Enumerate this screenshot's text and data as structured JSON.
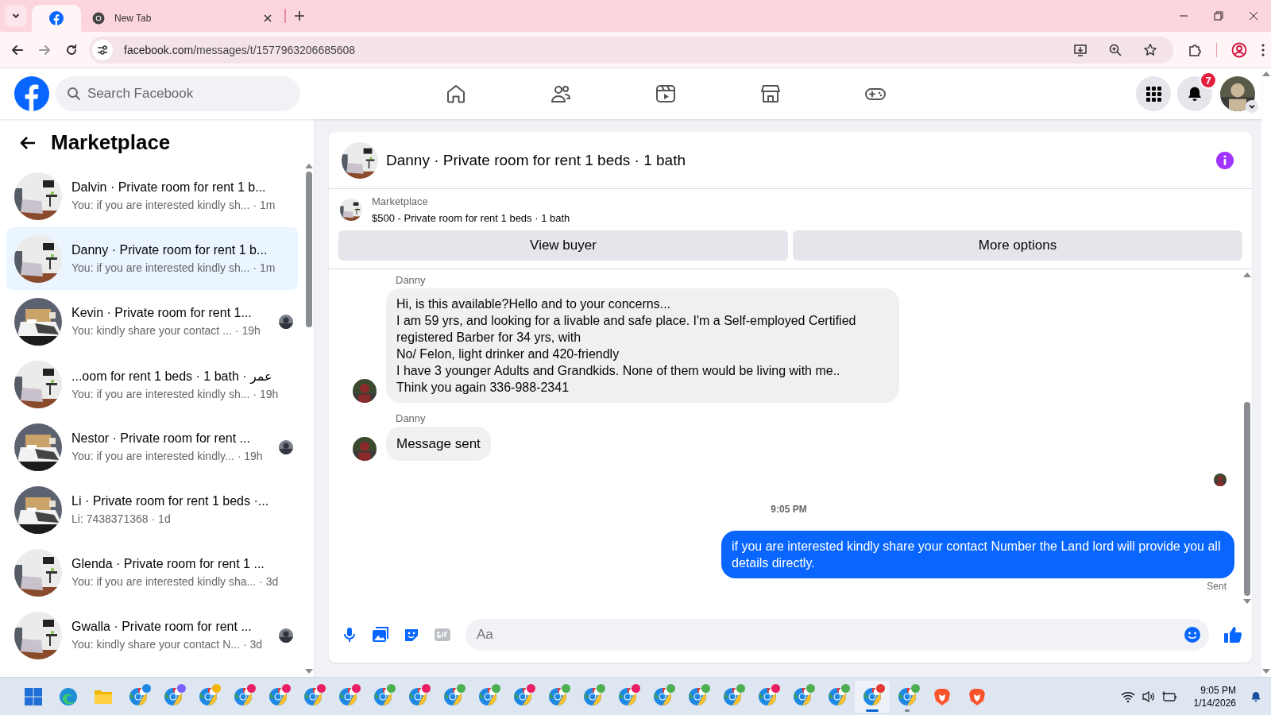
{
  "browser": {
    "tabs": [
      {
        "kind": "facebook",
        "selected": true
      },
      {
        "title": "New Tab",
        "kind": "chrome",
        "selected": false
      }
    ],
    "url_host": "facebook.com",
    "url_path": "/messages/t/1577963206685608"
  },
  "header": {
    "search": {
      "placeholder": "Search Facebook"
    },
    "nav": [
      {
        "kind": "home",
        "selected": false
      },
      {
        "kind": "friends",
        "selected": false
      },
      {
        "kind": "video",
        "selected": false
      },
      {
        "kind": "marketplace",
        "selected": false
      },
      {
        "kind": "gaming",
        "selected": false
      }
    ],
    "notification_count": "7"
  },
  "sidebar": {
    "title": "Marketplace",
    "conversations": [
      {
        "title": "Dalvin · Private room for rent 1 b...",
        "preview": "You: if you are interested kindly sh...",
        "time": "· 1m",
        "selected": false,
        "seen_avatar": false
      },
      {
        "title": "Danny · Private room for rent 1 b...",
        "preview": "You: if you are interested kindly sh...",
        "time": "· 1m",
        "selected": true,
        "seen_avatar": false
      },
      {
        "title": "Kevin · Private room for rent 1...",
        "preview": "You: kindly share your contact ...",
        "time": "· 19h",
        "selected": false,
        "seen_avatar": true
      },
      {
        "title": "...oom for rent 1 beds · 1 bath · عمر",
        "preview": "You: if you are interested kindly sh...",
        "time": "· 19h",
        "selected": false,
        "seen_avatar": false
      },
      {
        "title": "Nestor · Private room for rent ...",
        "preview": "You: if you are interested kindly...",
        "time": "· 19h",
        "selected": false,
        "seen_avatar": true
      },
      {
        "title": "Li · Private room for rent 1 beds ·...",
        "preview": "Li: 7438371368",
        "time": "· 1d",
        "selected": false,
        "seen_avatar": false
      },
      {
        "title": "Glenda · Private room for rent 1 ...",
        "preview": "You: if you are interested kindly sha...",
        "time": "· 3d",
        "selected": false,
        "seen_avatar": false
      },
      {
        "title": "Gwalla · Private room for rent ...",
        "preview": "You: kindly share your contact N...",
        "time": "· 3d",
        "selected": false,
        "seen_avatar": true
      }
    ]
  },
  "chat": {
    "title": "Danny · Private room for rent 1 beds · 1 bath",
    "listing": {
      "source": "Marketplace",
      "text": "$500 - Private room for rent 1 beds · 1 bath"
    },
    "buttons": [
      "View buyer",
      "More options"
    ],
    "messages": [
      {
        "kind": "incoming",
        "sender": "Danny",
        "text": "Hi, is this available?Hello and to your concerns...\nI am 59 yrs, and looking for a livable and safe place. I'm a Self-employed Certified registered Barber for 34 yrs, with\nNo/ Felon, light drinker and 420-friendly\nI have 3 younger Adults and Grandkids. None of them would be living with me..\nThink you again 336-988-2341"
      },
      {
        "kind": "notice",
        "sender": "Danny",
        "text": "Message sent"
      },
      {
        "kind": "receipt"
      },
      {
        "kind": "timestamp",
        "text": "9:05 PM"
      },
      {
        "kind": "outgoing",
        "text": "if you are interested kindly share your contact Number the Land lord will provide you all details directly.",
        "status": "Sent"
      }
    ],
    "composer": {
      "placeholder": "Aa"
    }
  },
  "taskbar": {
    "apps": [
      {
        "kind": "windows",
        "active": false,
        "running": false
      },
      {
        "kind": "edge",
        "active": false,
        "running": false
      },
      {
        "kind": "folder",
        "active": false,
        "running": false
      },
      {
        "kind": "profile",
        "color": "#1e88e5",
        "active": false,
        "running": false
      },
      {
        "kind": "chrome",
        "color": "#7b61ff",
        "active": false,
        "running": false
      },
      {
        "kind": "profile",
        "color": "#f4b400",
        "active": false,
        "running": false
      },
      {
        "kind": "profile",
        "color": "#e91e63",
        "active": false,
        "running": false
      },
      {
        "kind": "profile",
        "color": "#e91e63",
        "active": false,
        "running": false
      },
      {
        "kind": "profile",
        "color": "#e91e63",
        "active": false,
        "running": false
      },
      {
        "kind": "profile",
        "color": "#e91e63",
        "active": false,
        "running": false
      },
      {
        "kind": "profile",
        "color": "#4caf50",
        "active": false,
        "running": false
      },
      {
        "kind": "profile",
        "color": "#e91e63",
        "active": false,
        "running": false
      },
      {
        "kind": "profile",
        "color": "#4caf50",
        "active": false,
        "running": false
      },
      {
        "kind": "profile",
        "color": "#4caf50",
        "active": false,
        "running": false
      },
      {
        "kind": "profile",
        "color": "#e91e63",
        "active": false,
        "running": false
      },
      {
        "kind": "profile",
        "color": "#4caf50",
        "active": false,
        "running": false
      },
      {
        "kind": "profile",
        "color": "#4caf50",
        "active": false,
        "running": false
      },
      {
        "kind": "profile",
        "color": "#e91e63",
        "active": false,
        "running": false
      },
      {
        "kind": "profile",
        "color": "#4caf50",
        "active": false,
        "running": false
      },
      {
        "kind": "profile",
        "color": "#4caf50",
        "active": false,
        "running": false
      },
      {
        "kind": "profile",
        "color": "#4caf50",
        "active": false,
        "running": false
      },
      {
        "kind": "profile",
        "color": "#e91e63",
        "active": false,
        "running": false
      },
      {
        "kind": "profile",
        "color": "#4caf50",
        "active": false,
        "running": false
      },
      {
        "kind": "chrome",
        "color": "#4caf50",
        "active": false,
        "running": false
      },
      {
        "kind": "chrome",
        "color": "#e53935",
        "active": true,
        "running": true
      },
      {
        "kind": "chrome",
        "color": "#4caf50",
        "active": false,
        "running": true
      },
      {
        "kind": "brave",
        "active": false,
        "running": false
      },
      {
        "kind": "brave",
        "active": false,
        "running": false
      }
    ],
    "time": "9:05 PM",
    "date": "1/14/2026"
  }
}
